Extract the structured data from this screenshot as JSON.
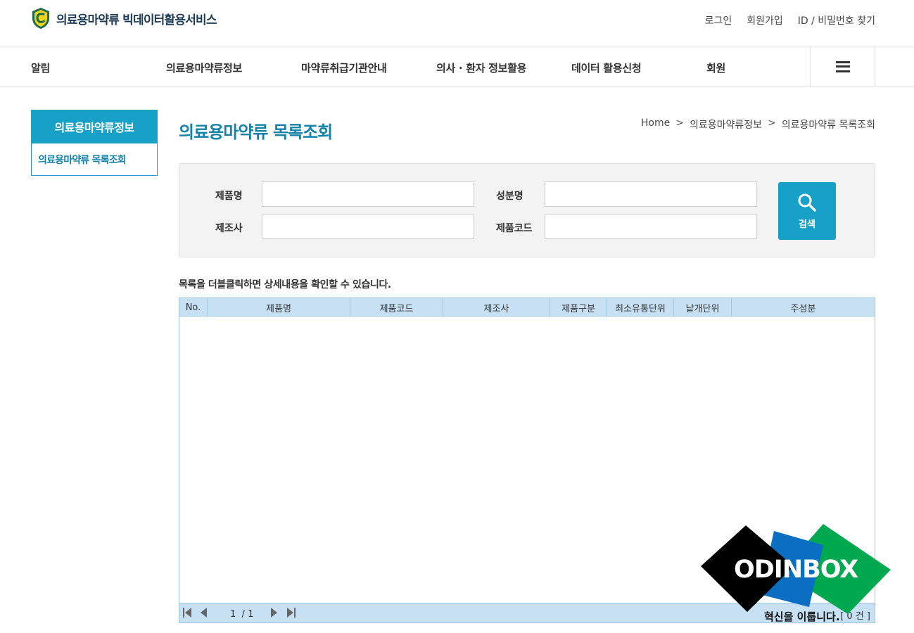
{
  "header": {
    "logo_text": "의료용마약류 빅데이터활용서비스",
    "util_links": [
      "로그인",
      "회원가입",
      "ID / 비밀번호 찾기"
    ]
  },
  "gnb": {
    "items": [
      "알림",
      "의료용마약류정보",
      "마약류취급기관안내",
      "의사 · 환자 정보활용",
      "데이터 활용신청",
      "회원"
    ]
  },
  "lnb": {
    "title": "의료용마약류정보",
    "sub": "의료용마약류 목록조회"
  },
  "page": {
    "title": "의료용마약류 목록조회",
    "breadcrumb": [
      "Home",
      "의료용마약류정보",
      "의료용마약류 목록조회"
    ],
    "breadcrumb_sep": ">"
  },
  "search": {
    "fields": [
      {
        "label": "제품명",
        "value": "",
        "placeholder": ""
      },
      {
        "label": "성분명",
        "value": "",
        "placeholder": ""
      },
      {
        "label": "제조사",
        "value": "",
        "placeholder": ""
      },
      {
        "label": "제품코드",
        "value": "",
        "placeholder": ""
      }
    ],
    "button_label": "검색"
  },
  "hint": "목록을 더블클릭하면 상세내용을 확인할 수 있습니다.",
  "grid": {
    "columns": [
      "No.",
      "제품명",
      "제품코드",
      "제조사",
      "제품구분",
      "최소유통단위",
      "낱개단위",
      "주성분"
    ],
    "rows": [],
    "page_current": "1",
    "page_total": "1",
    "page_sep": "/",
    "count_text": "[ 0 건 ]"
  },
  "watermark": {
    "brand": "ODINBOX",
    "slogan": "혁신을 이룹니다."
  },
  "colors": {
    "accent": "#17a1c9",
    "grid_header": "#c7e0f4"
  }
}
